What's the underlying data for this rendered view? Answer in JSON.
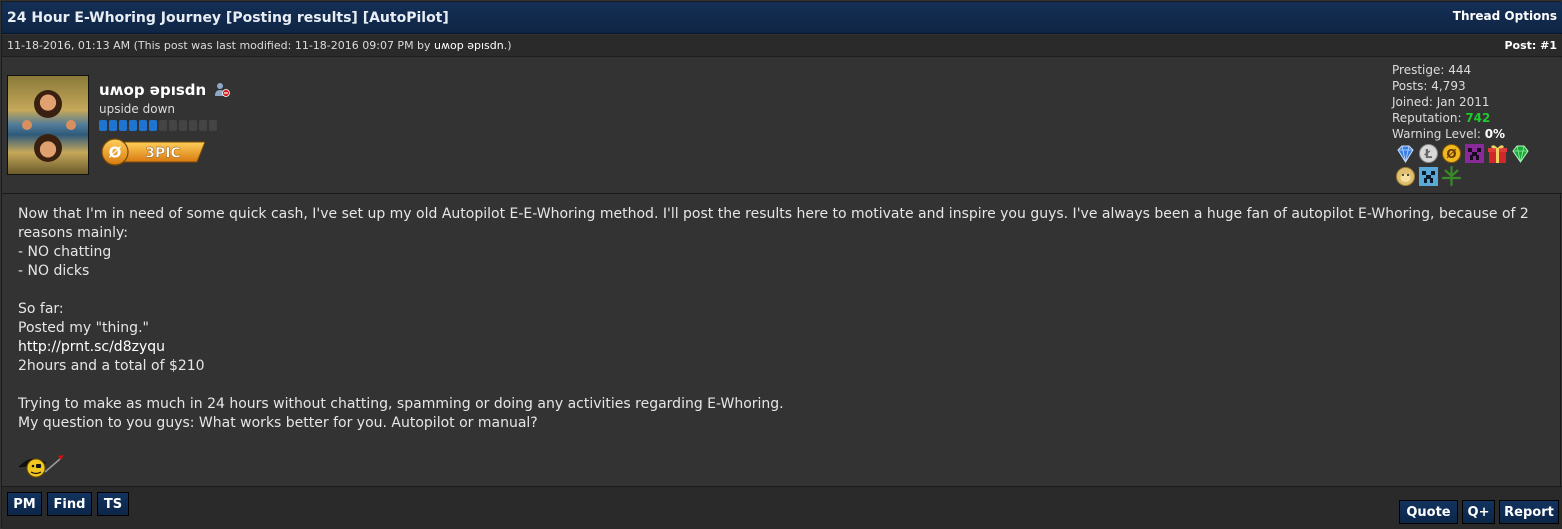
{
  "thread": {
    "title": "24 Hour E-Whoring Journey [Posting results] [AutoPilot]",
    "options_label": "Thread Options"
  },
  "post": {
    "date_text": "11-18-2016, 01:13 AM (This post was last modified: 11-18-2016 09:07 PM by ",
    "modified_by": "uʍop ǝpısdn",
    "date_suffix": ".)",
    "post_number": "Post: #1"
  },
  "author": {
    "username": "uʍop ǝpısdn",
    "usertitle": "upside down",
    "rep_pips_on": 6,
    "rep_pips_total": 12,
    "userbar_text": "3PIC",
    "userbar_icon": "Ø",
    "stats": {
      "prestige_label": "Prestige:",
      "prestige_value": "444",
      "posts_label": "Posts:",
      "posts_value": "4,793",
      "joined_label": "Joined:",
      "joined_value": "Jan 2011",
      "reputation_label": "Reputation:",
      "reputation_value": "742",
      "warning_label": "Warning Level:",
      "warning_value": "0%"
    },
    "awards": [
      "diamond-award-icon",
      "bitcoin-award-icon",
      "zero-award-icon",
      "creeper-purple-award-icon",
      "gift-award-icon",
      "emerald-award-icon",
      "doge-award-icon",
      "creeper-blue-award-icon",
      "leaf-award-icon"
    ]
  },
  "content": {
    "line1": "Now that I'm in need of some quick cash, I've set up my old Autopilot E-E-Whoring method. I'll post the results here to motivate and inspire you guys. I've always been a huge fan of autopilot E-Whoring, because of 2 reasons mainly:",
    "line2": "- NO chatting",
    "line3": "- NO dicks",
    "line4": "So far:",
    "line5": "Posted my \"thing.\"",
    "link": "http://prnt.sc/d8zyqu",
    "line6": "2hours and a total of $210",
    "line7": "Trying to make as much in 24 hours without chatting, spamming or doing any activities regarding E-Whoring.",
    "line8": "My question to you guys: What works better for you. Autopilot or manual?"
  },
  "buttons": {
    "pm": "PM",
    "find": "Find",
    "ts": "TS",
    "quote": "Quote",
    "qplus": "Q+",
    "report": "Report"
  },
  "colors": {
    "title_bar": "#12335f",
    "reputation_green": "#1fca2a",
    "rep_pip_blue": "#1e74d0",
    "userbar_orange": "#f0a020"
  }
}
